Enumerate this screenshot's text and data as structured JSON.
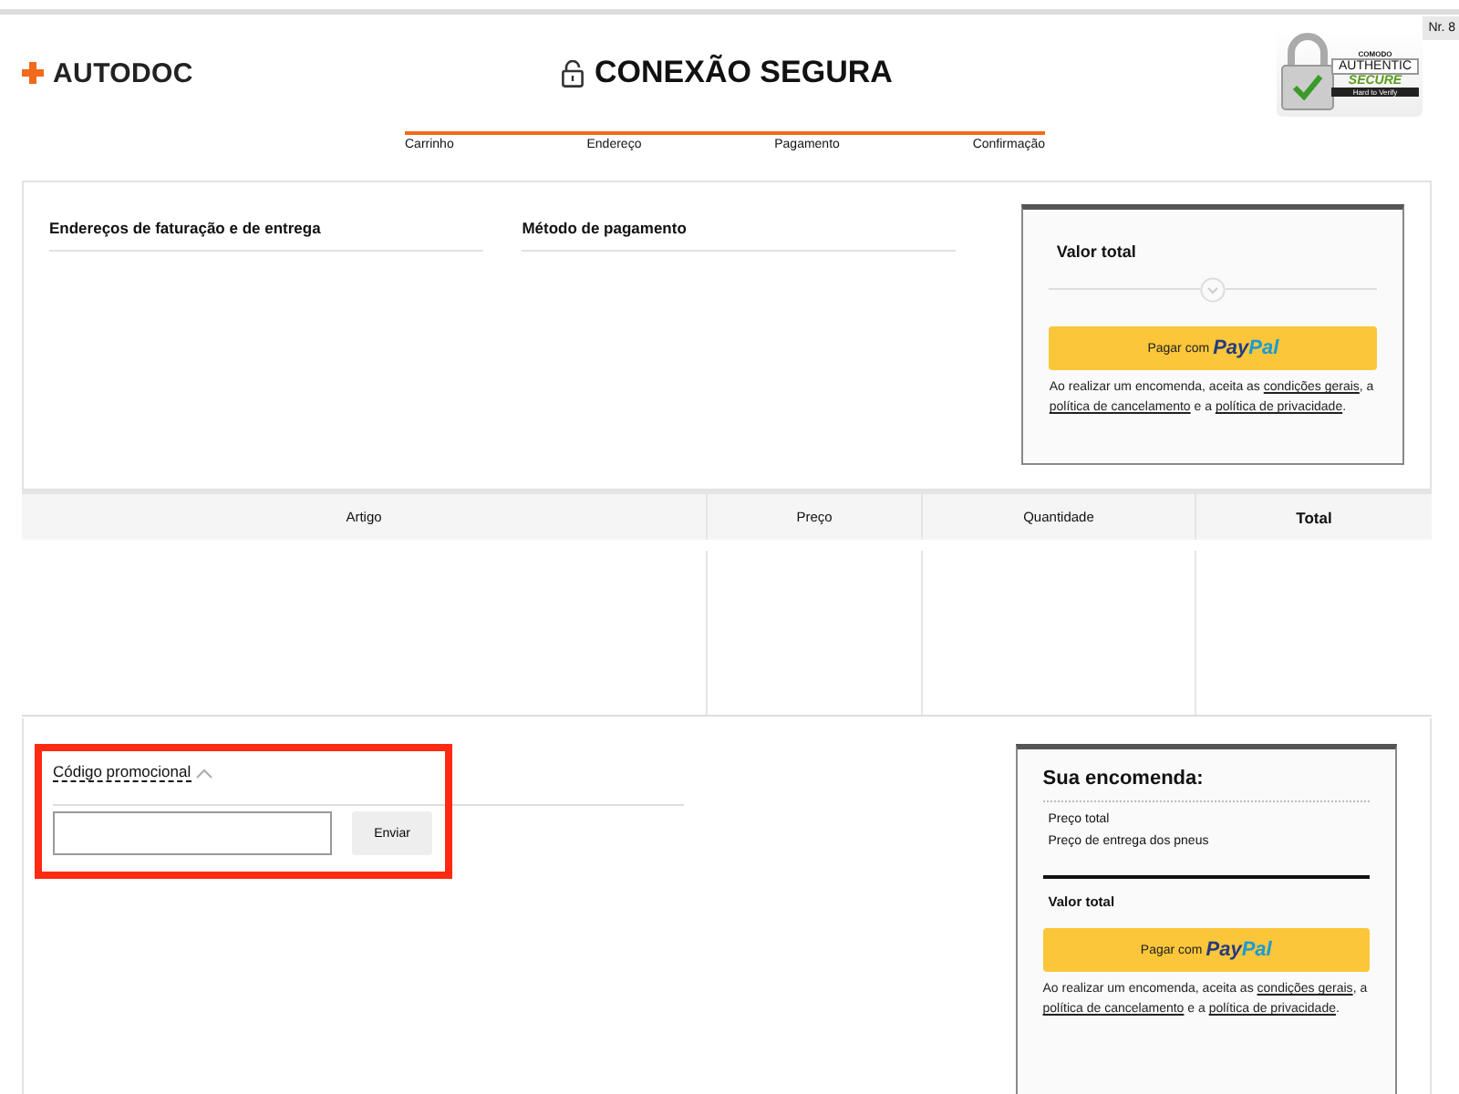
{
  "corner_badge": "Nr. 8",
  "logo": {
    "text": "AUTODOC"
  },
  "title": "CONEXÃO SEGURA",
  "seal": {
    "brand": "COMODO",
    "line1": "AUTHENTIC",
    "line2": "SECURE",
    "line3": "Hard to Verify"
  },
  "steps": [
    "Carrinho",
    "Endereço",
    "Pagamento",
    "Confirmação"
  ],
  "sections": [
    "Endereços de faturação e de entrega",
    "Método de pagamento"
  ],
  "top_card": {
    "heading": "Valor total",
    "pay_label": "Pagar com",
    "pay_brand": [
      "Pay",
      "Pal"
    ],
    "legal": [
      {
        "kind": "text",
        "text": "Ao realizar um encomenda, aceita as "
      },
      {
        "kind": "link",
        "text": "condições gerais"
      },
      {
        "kind": "text",
        "text": ", a "
      },
      {
        "kind": "link",
        "text": "política de cancelamento"
      },
      {
        "kind": "text",
        "text": " e a "
      },
      {
        "kind": "link",
        "text": "política de privacidade"
      },
      {
        "kind": "text",
        "text": "."
      }
    ]
  },
  "table": {
    "columns": [
      {
        "label": "Artigo",
        "bold": false
      },
      {
        "label": "Preço",
        "bold": false
      },
      {
        "label": "Quantidade",
        "bold": false
      },
      {
        "label": "Total",
        "bold": true
      }
    ]
  },
  "promo": {
    "label": "Código promocional",
    "expanded": true,
    "button": "Enviar"
  },
  "order_card": {
    "heading": "Sua encomenda:",
    "lines": [
      "Preço total",
      "Preço de entrega dos pneus"
    ],
    "total": "Valor total",
    "pay_label": "Pagar com",
    "pay_brand": [
      "Pay",
      "Pal"
    ],
    "legal": [
      {
        "kind": "text",
        "text": "Ao realizar um encomenda, aceita as "
      },
      {
        "kind": "link",
        "text": "condições gerais"
      },
      {
        "kind": "text",
        "text": ", a "
      },
      {
        "kind": "link",
        "text": "política de cancelamento"
      },
      {
        "kind": "text",
        "text": " e a "
      },
      {
        "kind": "link",
        "text": "política de privacidade"
      },
      {
        "kind": "text",
        "text": "."
      }
    ]
  }
}
